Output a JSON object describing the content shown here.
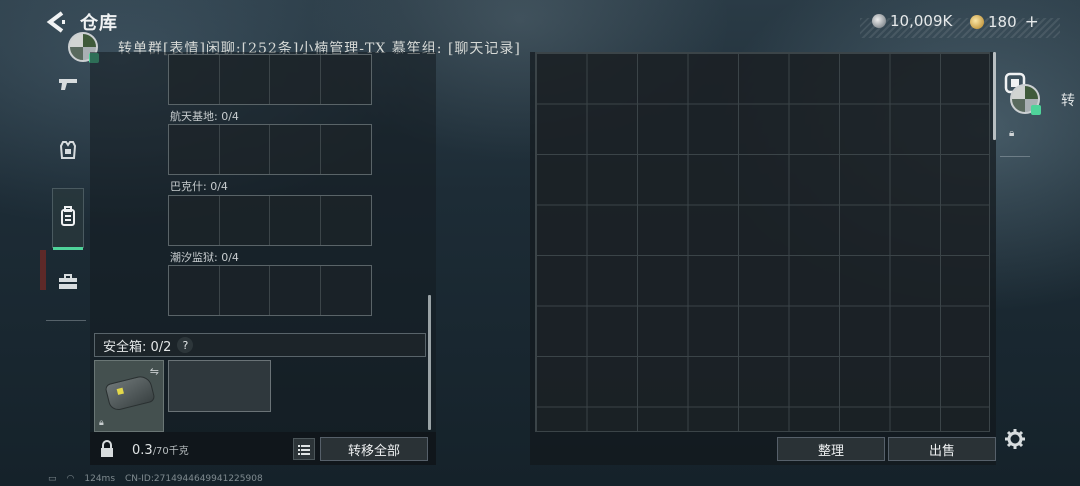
{
  "header": {
    "title": "仓库"
  },
  "currency": {
    "silver": "10,009K",
    "gold": "180"
  },
  "chat_overlay": "转单群[表情]闲聊:[252条]小楠管理-TX 慕笙组: [聊天记录]",
  "containers": [
    {
      "label": "航天基地: 0/4"
    },
    {
      "label": "巴克什: 0/4"
    },
    {
      "label": "潮汐监狱: 0/4"
    }
  ],
  "safe_box": {
    "label": "安全箱: 0/2",
    "help": "?"
  },
  "weight": {
    "current": "0.3",
    "max": "/70千克"
  },
  "buttons": {
    "transfer_all": "转移全部",
    "sort": "整理",
    "sell": "出售"
  },
  "side_tab_char": "转",
  "status_bar": {
    "ping": "124ms",
    "id": "CN-ID:2714944649941225908"
  },
  "colors": {
    "accent_green": "#4fd39a"
  }
}
